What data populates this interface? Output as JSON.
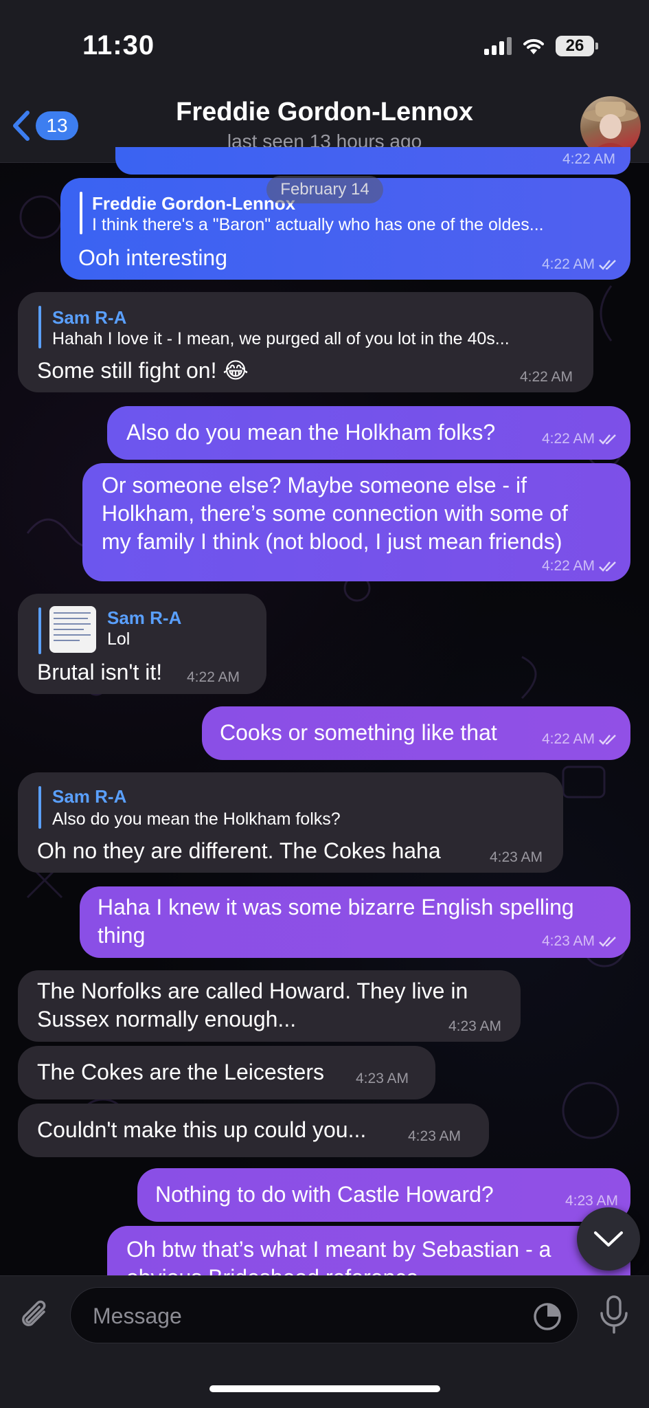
{
  "status_bar": {
    "time": "11:30",
    "battery": "26"
  },
  "header": {
    "back_count": "13",
    "title": "Freddie Gordon-Lennox",
    "subtitle": "last seen 13 hours ago"
  },
  "date_pill": "February 14",
  "top_partial": {
    "time": "4:22 AM"
  },
  "messages": [
    {
      "reply_name": "Freddie Gordon-Lennox",
      "reply_text": "I think there's a \"Baron\" actually who has one of the oldes...",
      "text": "Ooh interesting",
      "time": "4:22 AM"
    },
    {
      "reply_name": "Sam R-A",
      "reply_text": "Hahah I love it - I mean, we purged all of you lot in the 40s...",
      "text": "Some still fight on! 😂",
      "time": "4:22 AM"
    },
    {
      "text": "Also do you mean the Holkham folks?",
      "time": "4:22 AM"
    },
    {
      "lines": [
        "Or someone else? Maybe someone else - if",
        "Holkham, there’s some connection with some of",
        "my family I think (not blood, I just mean friends)"
      ],
      "time": "4:22 AM"
    },
    {
      "reply_name": "Sam R-A",
      "reply_text": "Lol",
      "text": "Brutal isn't it!",
      "time": "4:22 AM"
    },
    {
      "text": "Cooks or something like that",
      "time": "4:22 AM"
    },
    {
      "reply_name": "Sam R-A",
      "reply_text": "Also do you mean the Holkham folks?",
      "text": "Oh no they are different. The Cokes haha",
      "time": "4:23 AM"
    },
    {
      "lines": [
        "Haha I knew it was some bizarre English spelling",
        "thing"
      ],
      "time": "4:23 AM"
    },
    {
      "lines": [
        "The Norfolks are called Howard. They live in",
        "Sussex normally enough..."
      ],
      "time": "4:23 AM"
    },
    {
      "text": "The Cokes are the Leicesters",
      "time": "4:23 AM"
    },
    {
      "text": "Couldn't make this up could you...",
      "time": "4:23 AM"
    },
    {
      "text": "Nothing to do with Castle Howard?",
      "time": "4:23 AM"
    },
    {
      "lines": [
        "Oh btw that’s what I meant by Sebastian - a",
        "obvious Brideshead reference"
      ]
    }
  ],
  "input": {
    "placeholder": "Message"
  },
  "icons": {
    "back": "chevron-left-icon",
    "attach": "paperclip-icon",
    "sticker": "sticker-icon",
    "mic": "microphone-icon",
    "scroll": "chevron-down-icon"
  },
  "colors": {
    "outgoing_blue": "#3a63f2",
    "outgoing_purple": "#8a4fe6",
    "incoming": "#2b2830",
    "accent": "#3d7ef0"
  }
}
